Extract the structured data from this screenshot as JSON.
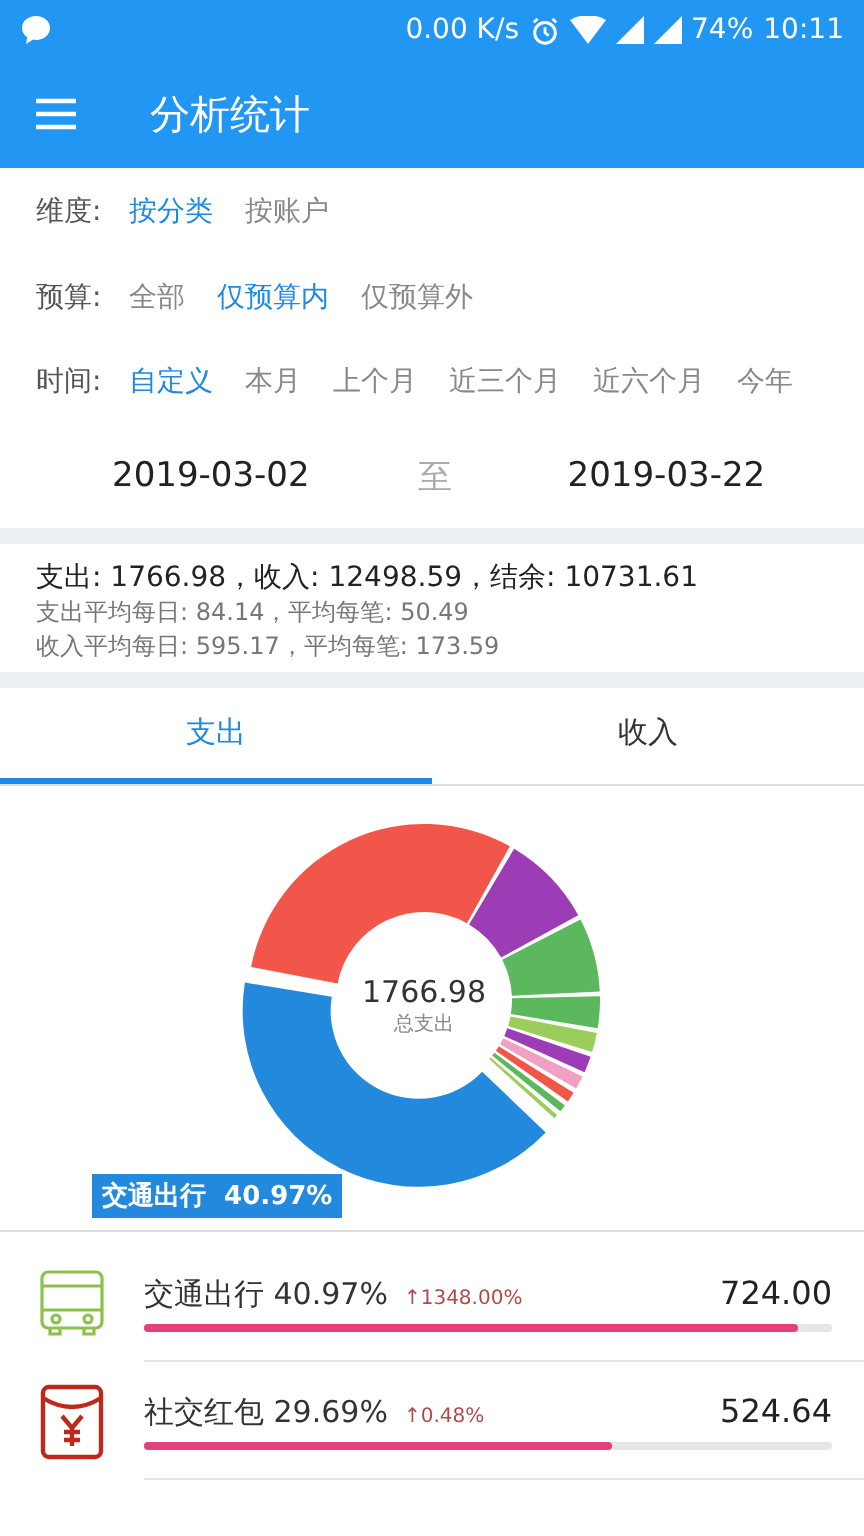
{
  "status_bar": {
    "speed": "0.00 K/s",
    "battery": "74%",
    "time": "10:11"
  },
  "app_bar": {
    "title": "分析统计"
  },
  "filters": [
    {
      "label": "维度:",
      "options": [
        {
          "text": "按分类",
          "selected": true
        },
        {
          "text": "按账户",
          "selected": false
        }
      ]
    },
    {
      "label": "预算:",
      "options": [
        {
          "text": "全部",
          "selected": false
        },
        {
          "text": "仅预算内",
          "selected": true
        },
        {
          "text": "仅预算外",
          "selected": false
        }
      ]
    },
    {
      "label": "时间:",
      "options": [
        {
          "text": "自定义",
          "selected": true
        },
        {
          "text": "本月",
          "selected": false
        },
        {
          "text": "上个月",
          "selected": false
        },
        {
          "text": "近三个月",
          "selected": false
        },
        {
          "text": "近六个月",
          "selected": false
        },
        {
          "text": "今年",
          "selected": false
        }
      ]
    }
  ],
  "date_range": {
    "from": "2019-03-02",
    "separator": "至",
    "to": "2019-03-22"
  },
  "summary": {
    "main": "支出: 1766.98，收入: 12498.59，结余: 10731.61",
    "expense_avg": "支出平均每日: 84.14，平均每笔: 50.49",
    "income_avg": "收入平均每日: 595.17，平均每笔: 173.59"
  },
  "tabs": [
    {
      "label": "支出",
      "selected": true
    },
    {
      "label": "收入",
      "selected": false
    }
  ],
  "donut": {
    "center_value": "1766.98",
    "center_label": "总支出",
    "highlight_label": "交通出行  40.97%"
  },
  "categories": [
    {
      "kind": "bus",
      "name": "交通出行 40.97%",
      "change": "↑1348.00%",
      "amount": "724.00",
      "level": 0.95
    },
    {
      "kind": "red-envelope",
      "name": "社交红包 29.69%",
      "change": "↑0.48%",
      "amount": "524.64",
      "level": 0.68
    }
  ]
}
